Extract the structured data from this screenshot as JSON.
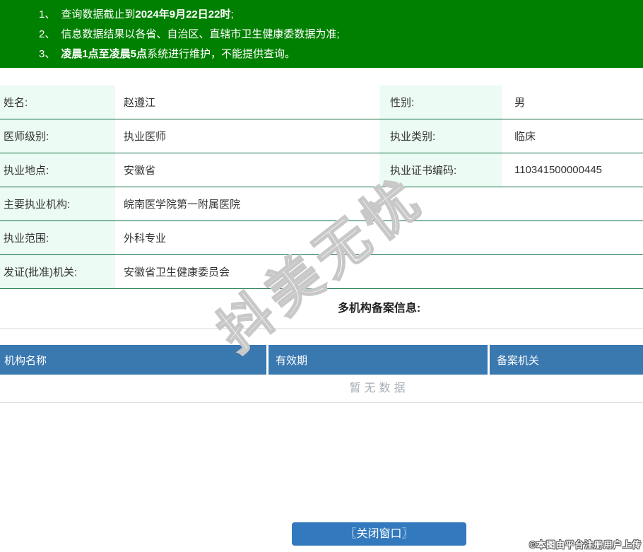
{
  "notice": {
    "items": [
      {
        "num": "1、",
        "pre": "查询数据截止到",
        "bold": "2024年9月22日22时",
        "post": ";"
      },
      {
        "num": "2、",
        "pre": "信息数据结果以各省、自治区、直辖市卫生健康委数据为准;",
        "bold": "",
        "post": ""
      },
      {
        "num": "3、",
        "pre": "",
        "bold": "凌晨1点至凌晨5点",
        "post": "系统进行维护，不能提供查询。"
      }
    ]
  },
  "profile": {
    "rows": [
      {
        "label1": "姓名:",
        "value1": "赵遵江",
        "label2": "性别:",
        "value2": "男"
      },
      {
        "label1": "医师级别:",
        "value1": "执业医师",
        "label2": "执业类别:",
        "value2": "临床"
      },
      {
        "label1": "执业地点:",
        "value1": "安徽省",
        "label2": "执业证书编码:",
        "value2": "110341500000445"
      },
      {
        "label1": "主要执业机构:",
        "value1": "皖南医学院第一附属医院"
      },
      {
        "label1": "执业范围:",
        "value1": "外科专业"
      },
      {
        "label1": "发证(批准)机关:",
        "value1": "安徽省卫生健康委员会"
      }
    ]
  },
  "multi_org": {
    "title": "多机构备案信息:",
    "columns": [
      "机构名称",
      "有效期",
      "备案机关"
    ],
    "empty_text": "暂无数据"
  },
  "footer": {
    "close_button": "〖关闭窗口〗",
    "attribution": "©本图由平台注册用户上传"
  },
  "watermark": "抖美无忧",
  "colors": {
    "banner_green": "#008000",
    "label_bg_mint": "#ecfbf3",
    "row_border_green": "#0c6b40",
    "table_header_blue": "#3a78b0",
    "button_blue": "#3279bd"
  }
}
